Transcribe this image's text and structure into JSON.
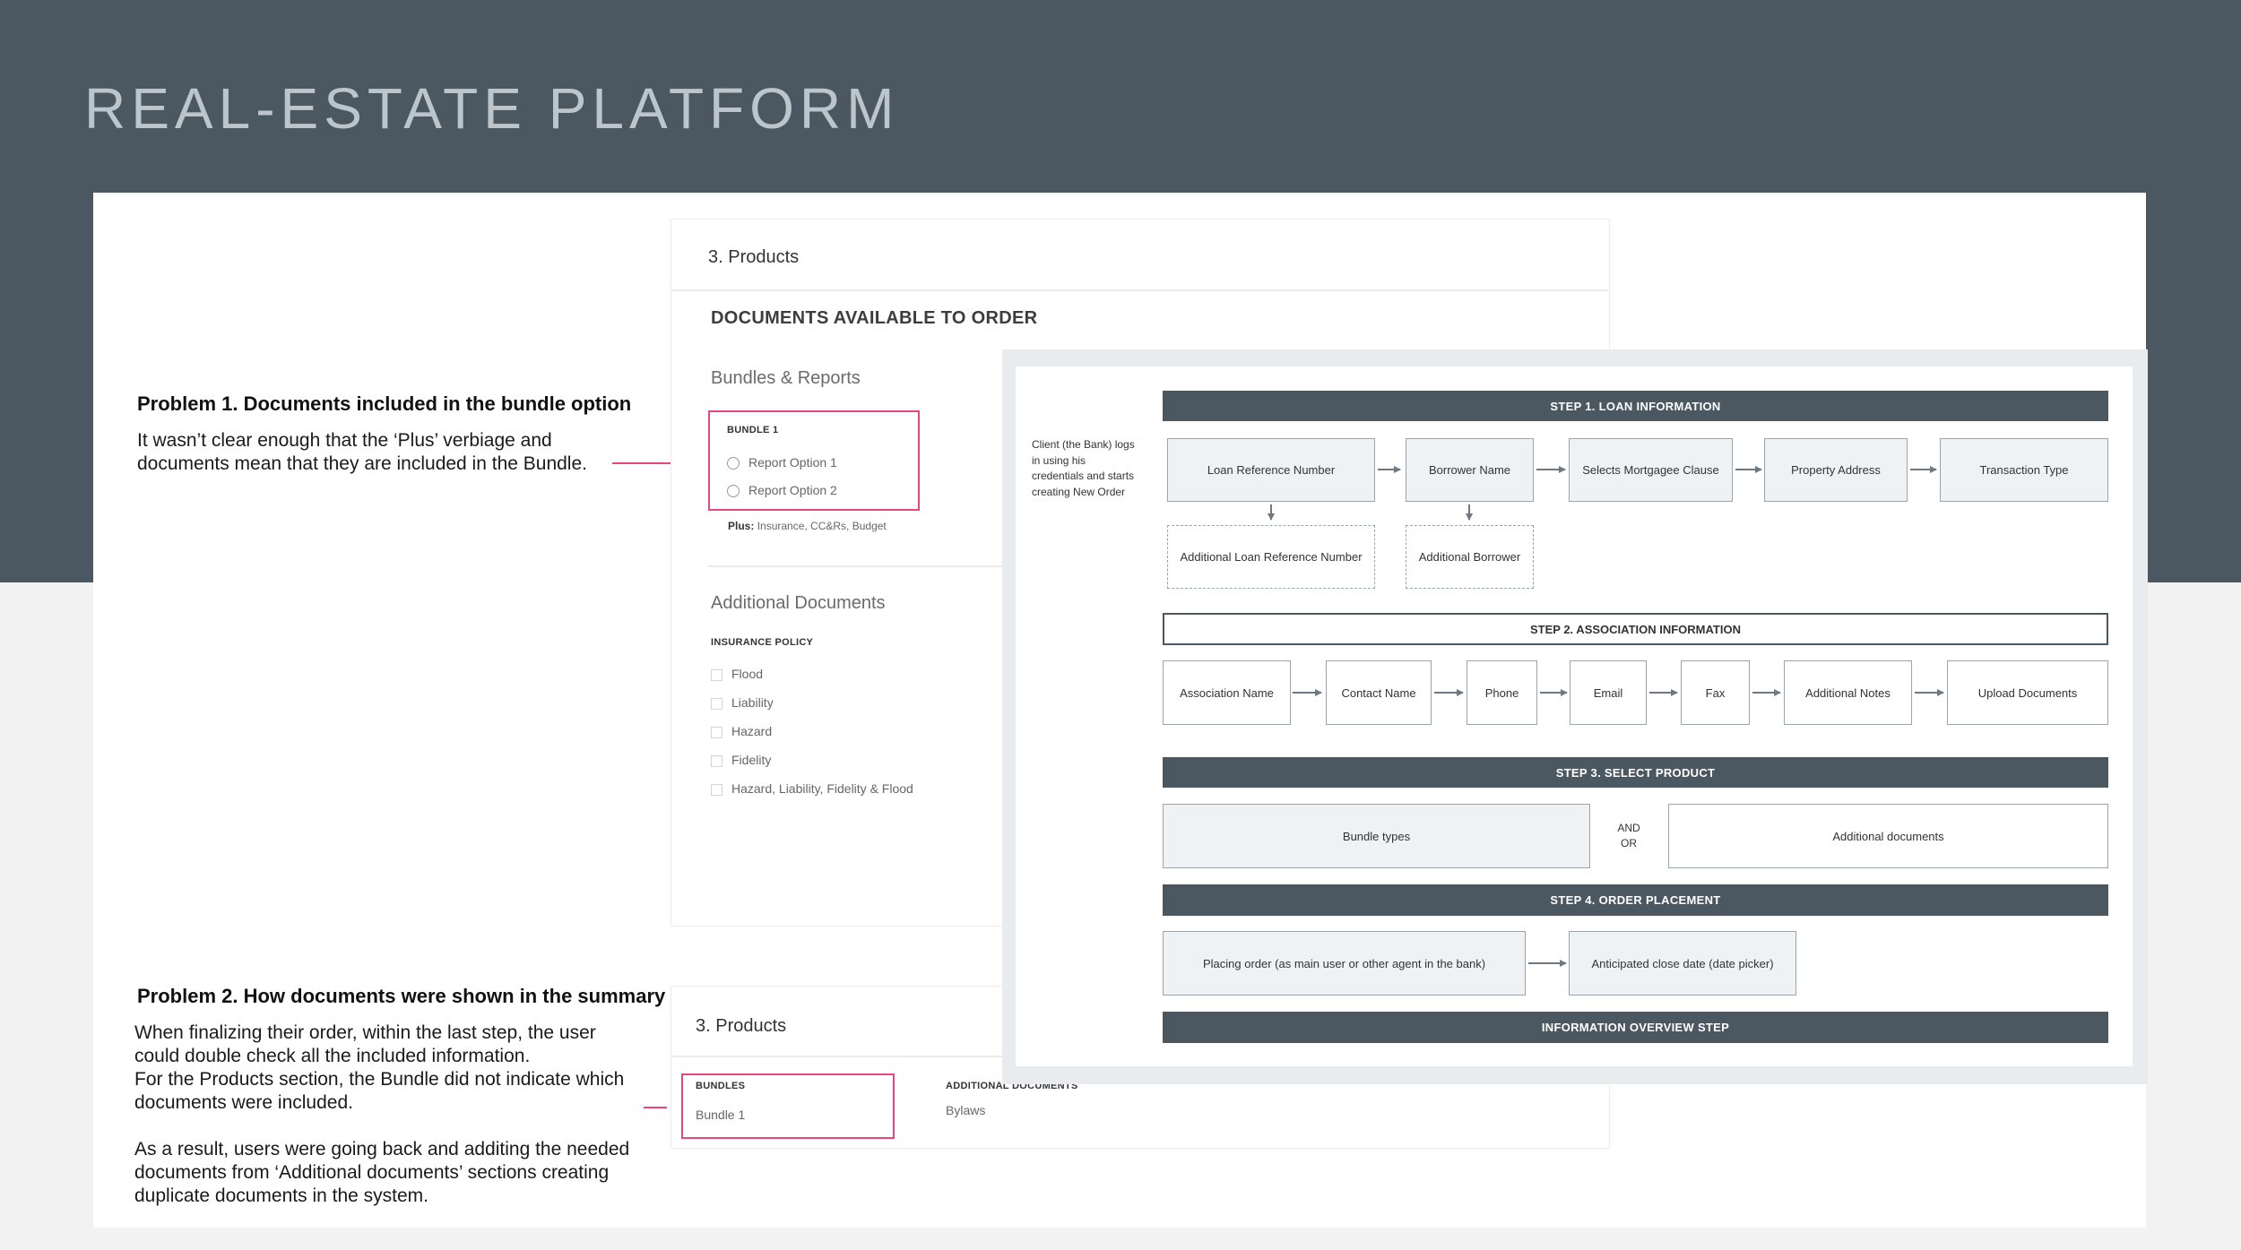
{
  "page": {
    "title": "REAL-ESTATE PLATFORM"
  },
  "problem1": {
    "title": "Problem 1. Documents included in the bundle option",
    "body": "It wasn’t clear enough that the ‘Plus’ verbiage and documents mean that they are included in the Bundle."
  },
  "problem2": {
    "title": "Problem 2. How documents were shown in the summary",
    "body1": "When finalizing their order, within the last step, the user could double check all the included information.",
    "body2": "For the Products section, the Bundle did not indicate which documents were included.",
    "body3": "As a result, users were going back and additing the needed documents from ‘Additional documents’ sections creating duplicate documents in the system."
  },
  "products_form": {
    "step_label": "3. Products",
    "section_title": "DOCUMENTS AVAILABLE TO ORDER",
    "bundles_heading": "Bundles & Reports",
    "bundle_caption": "BUNDLE 1",
    "options": [
      "Report Option 1",
      "Report Option 2"
    ],
    "plus_label": "Plus:",
    "plus_items": "Insurance, CC&Rs, Budget",
    "additional_heading": "Additional Documents",
    "insurance_caption": "INSURANCE POLICY",
    "insurance_options": [
      "Flood",
      "Liability",
      "Hazard",
      "Fidelity",
      "Hazard, Liability, Fidelity & Flood"
    ]
  },
  "summary": {
    "step_label": "3. Products",
    "bundles_caption": "BUNDLES",
    "bundle_value": "Bundle 1",
    "additional_caption": "ADDITIONAL DOCUMENTS",
    "additional_value": "Bylaws"
  },
  "flow": {
    "client_note": "Client (the Bank) logs in using his credentials and starts creating New Order",
    "step1": {
      "title": "STEP 1. LOAN INFORMATION",
      "nodes": [
        "Loan Reference Number",
        "Borrower Name",
        "Selects Mortgagee Clause",
        "Property Address",
        "Transaction Type"
      ],
      "optional": [
        "Additional Loan Reference Number",
        "Additional Borrower"
      ]
    },
    "step2": {
      "title": "STEP 2. ASSOCIATION INFORMATION",
      "nodes": [
        "Association Name",
        "Contact Name",
        "Phone",
        "Email",
        "Fax",
        "Additional Notes",
        "Upload Documents"
      ]
    },
    "step3": {
      "title": "STEP 3. SELECT PRODUCT",
      "left": "Bundle types",
      "andor_1": "AND",
      "andor_2": "OR",
      "right": "Additional documents"
    },
    "step4": {
      "title": "STEP 4. ORDER PLACEMENT",
      "nodes": [
        "Placing order (as main user or other agent in the bank)",
        "Anticipated close date (date picker)"
      ]
    },
    "overview": "INFORMATION OVERVIEW STEP"
  },
  "colors": {
    "header_bg": "#4b5861",
    "accent_pink": "#e8467e",
    "node_fill": "#eff2f5"
  }
}
